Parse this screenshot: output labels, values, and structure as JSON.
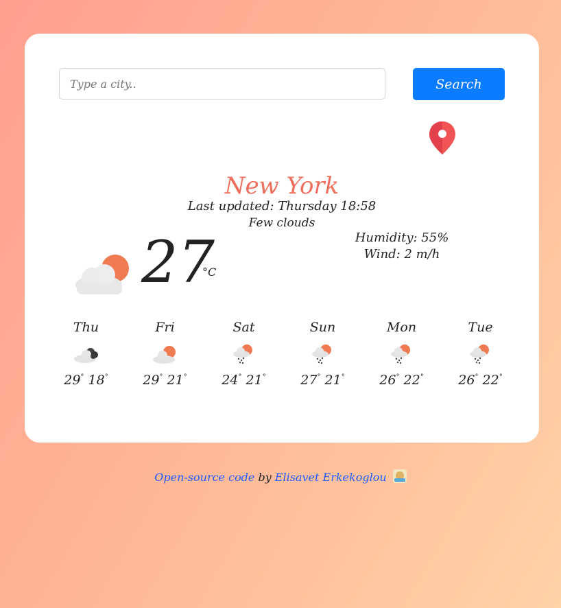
{
  "search": {
    "placeholder": "Type a city..",
    "value": "",
    "button_label": "Search"
  },
  "location": {
    "icon": "map-pin-icon",
    "color": "#f05454"
  },
  "current": {
    "city": "New York",
    "last_updated": "Last updated: Thursday 18:58",
    "description": "Few clouds",
    "temperature": "27",
    "unit": "°C",
    "humidity": "Humidity: 55%",
    "wind": "Wind: 2 m/h",
    "icon": "few-clouds-icon"
  },
  "forecast": [
    {
      "day": "Thu",
      "high": "29",
      "low": "18",
      "icon": "overcast-icon"
    },
    {
      "day": "Fri",
      "high": "29",
      "low": "21",
      "icon": "few-clouds-icon"
    },
    {
      "day": "Sat",
      "high": "24",
      "low": "21",
      "icon": "rain-icon"
    },
    {
      "day": "Sun",
      "high": "27",
      "low": "21",
      "icon": "rain-icon"
    },
    {
      "day": "Mon",
      "high": "26",
      "low": "22",
      "icon": "rain-icon"
    },
    {
      "day": "Tue",
      "high": "26",
      "low": "22",
      "icon": "rain-icon"
    }
  ],
  "footer": {
    "code_link": "Open-source code",
    "by": " by ",
    "author_link": "Elisavet Erkekoglou",
    "emoji": "technologist-emoji"
  },
  "colors": {
    "accent": "#0b7bff",
    "city": "#ef6f5c",
    "sun": "#f07a52",
    "cloud": "#e3e3e3"
  }
}
